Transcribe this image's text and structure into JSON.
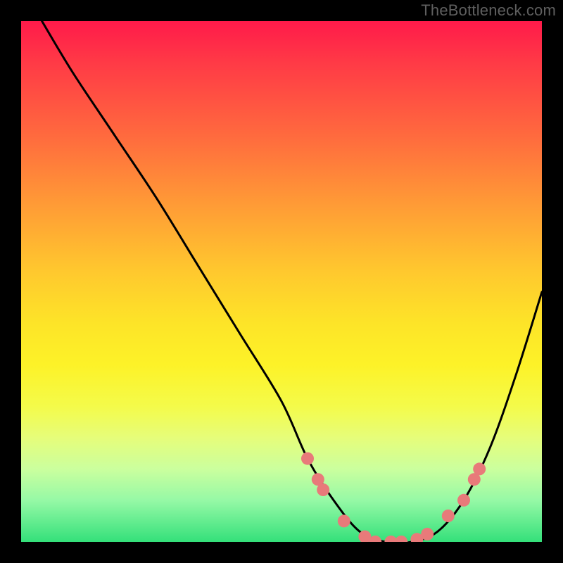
{
  "watermark": "TheBottleneck.com",
  "chart_data": {
    "type": "line",
    "title": "",
    "xlabel": "",
    "ylabel": "",
    "xlim": [
      0,
      100
    ],
    "ylim": [
      0,
      100
    ],
    "series": [
      {
        "name": "bottleneck-curve",
        "x": [
          4,
          10,
          18,
          26,
          34,
          42,
          50,
          55,
          60,
          65,
          70,
          75,
          80,
          85,
          90,
          95,
          100
        ],
        "y": [
          100,
          90,
          78,
          66,
          53,
          40,
          27,
          16,
          8,
          2,
          0,
          0,
          2,
          8,
          18,
          32,
          48
        ]
      }
    ],
    "markers": {
      "name": "highlight-points",
      "color": "#e87a7a",
      "points": [
        {
          "x": 55,
          "y": 16
        },
        {
          "x": 57,
          "y": 12
        },
        {
          "x": 58,
          "y": 10
        },
        {
          "x": 62,
          "y": 4
        },
        {
          "x": 66,
          "y": 1
        },
        {
          "x": 68,
          "y": 0
        },
        {
          "x": 71,
          "y": 0
        },
        {
          "x": 73,
          "y": 0
        },
        {
          "x": 76,
          "y": 0.5
        },
        {
          "x": 78,
          "y": 1.5
        },
        {
          "x": 82,
          "y": 5
        },
        {
          "x": 85,
          "y": 8
        },
        {
          "x": 87,
          "y": 12
        },
        {
          "x": 88,
          "y": 14
        }
      ]
    },
    "gradient_stops": [
      {
        "pos": 0,
        "color": "#ff1a4a"
      },
      {
        "pos": 50,
        "color": "#ffd228"
      },
      {
        "pos": 100,
        "color": "#34e07a"
      }
    ]
  }
}
